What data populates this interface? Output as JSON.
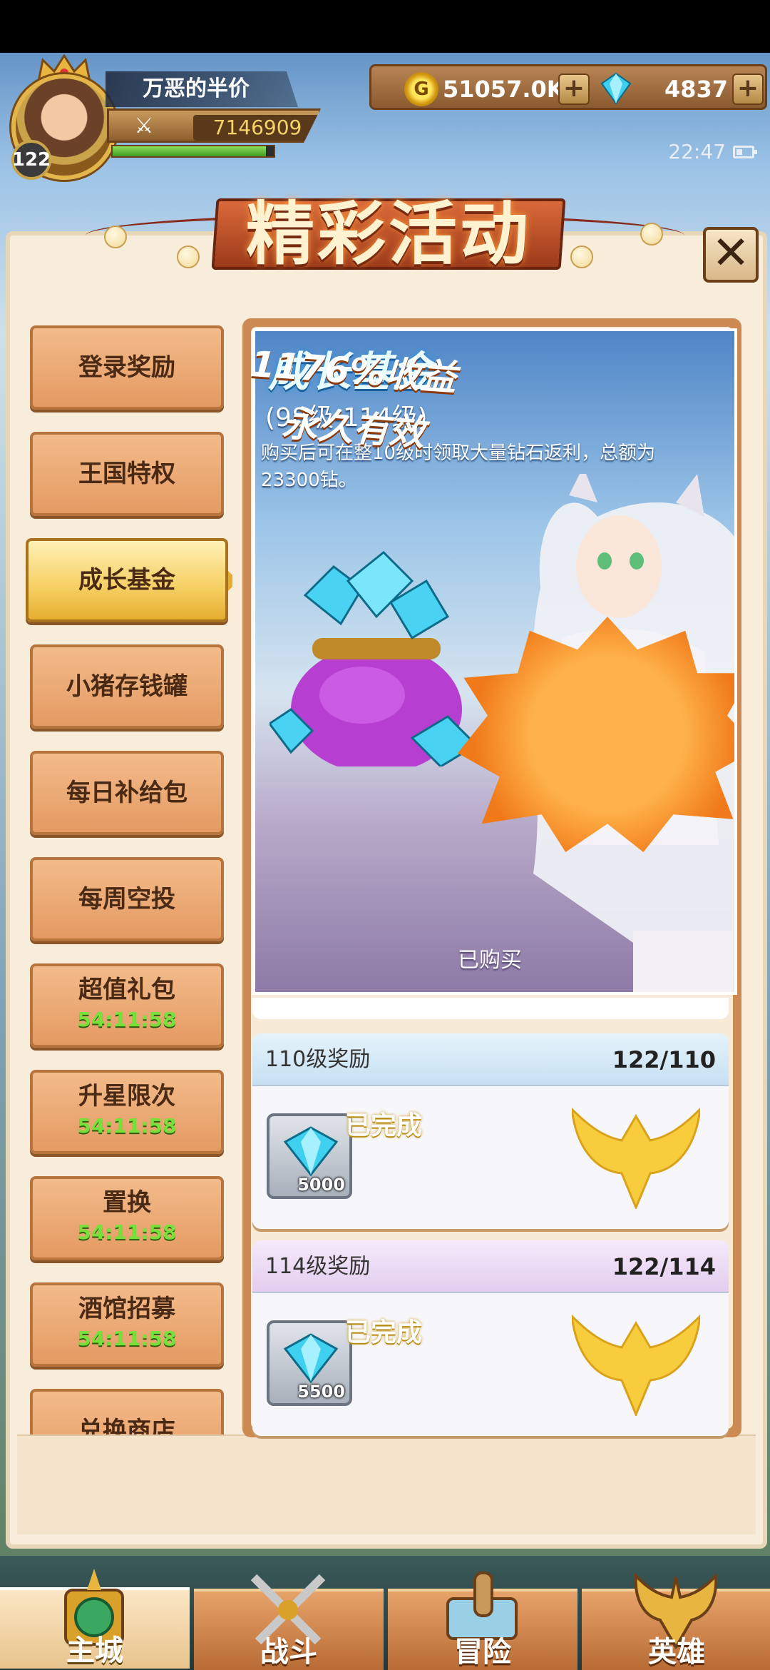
{
  "player": {
    "name": "万恶的半价",
    "level": "122",
    "power": "7146909",
    "exp_fraction": 0.95
  },
  "currency": {
    "gold": "51057.0K",
    "gems": "4837",
    "plus_symbol": "+"
  },
  "status": {
    "time": "22:47"
  },
  "popup": {
    "title": "精彩活动",
    "close_symbol": "✕"
  },
  "tabs": [
    {
      "label": "登录奖励"
    },
    {
      "label": "王国特权"
    },
    {
      "label": "成长基金",
      "active": true
    },
    {
      "label": "小猪存钱罐"
    },
    {
      "label": "每日补给包"
    },
    {
      "label": "每周空投"
    },
    {
      "label": "超值礼包",
      "timer": "54:11:58"
    },
    {
      "label": "升星限次",
      "timer": "54:11:58"
    },
    {
      "label": "置换",
      "timer": "54:11:58"
    },
    {
      "label": "酒馆招募",
      "timer": "54:11:58"
    },
    {
      "label": "兑换商店"
    }
  ],
  "banner": {
    "title": "成长基金",
    "range": "(98级-114级)",
    "description": "购买后可在整10级时领取大量钻石返利，总额为23300钻。",
    "burst_line1": "1176%收益",
    "burst_line2": "永久有效",
    "purchased": "已购买"
  },
  "rewards": [
    {
      "title": "110级奖励",
      "progress": "122/110",
      "item_count": "5000",
      "status": "已完成"
    },
    {
      "title": "114级奖励",
      "progress": "122/114",
      "item_count": "5500",
      "status": "已完成"
    }
  ],
  "bottom_nav": [
    {
      "label": "主城",
      "active": true
    },
    {
      "label": "战斗"
    },
    {
      "label": "冒险"
    },
    {
      "label": "英雄"
    }
  ],
  "colors": {
    "accent_gold": "#f5cf62",
    "tab_orange": "#e59a63",
    "timer_green": "#78e03a",
    "gem_cyan": "#3fd0f0"
  }
}
